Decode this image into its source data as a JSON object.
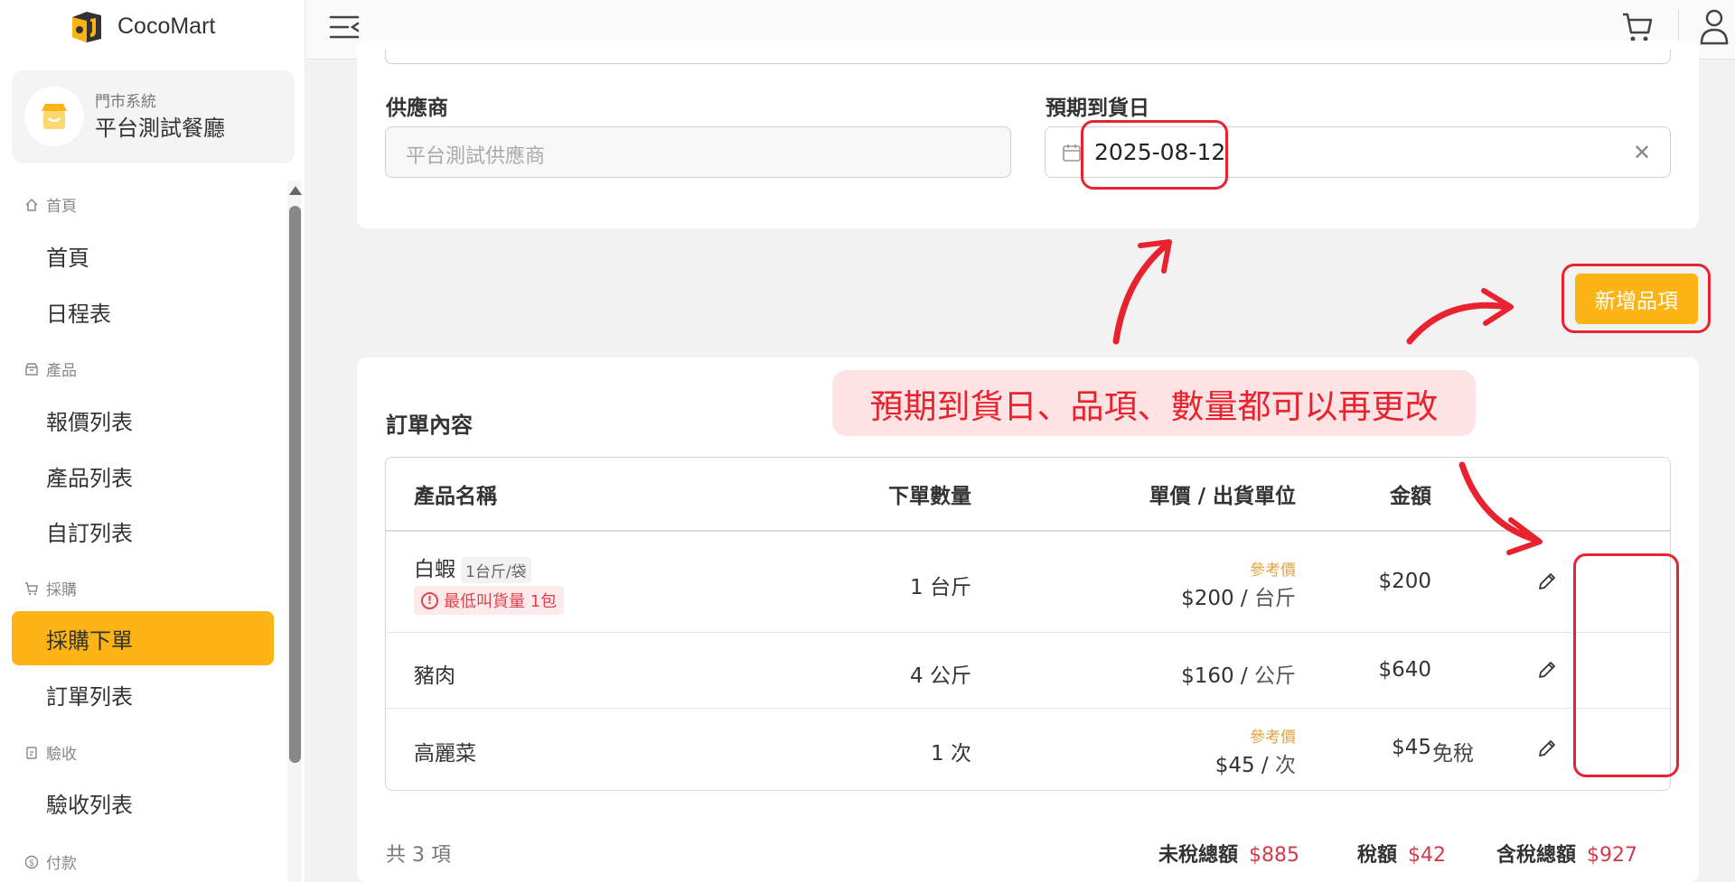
{
  "brand": {
    "name": "CocoMart"
  },
  "store": {
    "system_label": "門市系統",
    "name": "平台測試餐廳"
  },
  "sidebar": {
    "groups": [
      {
        "label": "首頁",
        "icon": "home-icon",
        "items": [
          "首頁",
          "日程表"
        ]
      },
      {
        "label": "產品",
        "icon": "box-icon",
        "items": [
          "報價列表",
          "產品列表",
          "自訂列表"
        ]
      },
      {
        "label": "採購",
        "icon": "cart-icon",
        "items": [
          "採購下單",
          "訂單列表"
        ]
      },
      {
        "label": "驗收",
        "icon": "clipboard-icon",
        "items": [
          "驗收列表"
        ]
      },
      {
        "label": "付款",
        "icon": "dollar-icon",
        "items": []
      }
    ],
    "active_item": "採購下單"
  },
  "form": {
    "supplier_label": "供應商",
    "supplier_value": "平台測試供應商",
    "date_label": "預期到貨日",
    "date_value": "2025-08-12"
  },
  "add_button_label": "新增品項",
  "annotation_text": "預期到貨日、品項、數量都可以再更改",
  "order": {
    "title": "訂單內容",
    "columns": [
      "產品名稱",
      "下單數量",
      "單價 / 出貨單位",
      "金額"
    ],
    "rows": [
      {
        "name": "白蝦",
        "spec": "1台斤/袋",
        "warning": "最低叫貨量 1包",
        "qty": "1 台斤",
        "ref": "參考價",
        "price": "$200",
        "unit": "台斤",
        "amount": "$200",
        "tax_note": ""
      },
      {
        "name": "豬肉",
        "spec": "",
        "warning": "",
        "qty": "4 公斤",
        "ref": "",
        "price": "$160",
        "unit": "公斤",
        "amount": "$640",
        "tax_note": ""
      },
      {
        "name": "高麗菜",
        "spec": "",
        "warning": "",
        "qty": "1 次",
        "ref": "參考價",
        "price": "$45",
        "unit": "次",
        "amount": "$45",
        "tax_note": "免稅"
      }
    ],
    "count_text": "共 3 項",
    "subtotal_label": "未稅總額",
    "subtotal": "$885",
    "tax_label": "稅額",
    "tax": "$42",
    "total_label": "含稅總額",
    "total": "$927"
  },
  "colors": {
    "accent": "#fcb414",
    "danger": "#e8232f",
    "price_red": "#d43b4a",
    "ref_orange": "#e2a23d"
  }
}
